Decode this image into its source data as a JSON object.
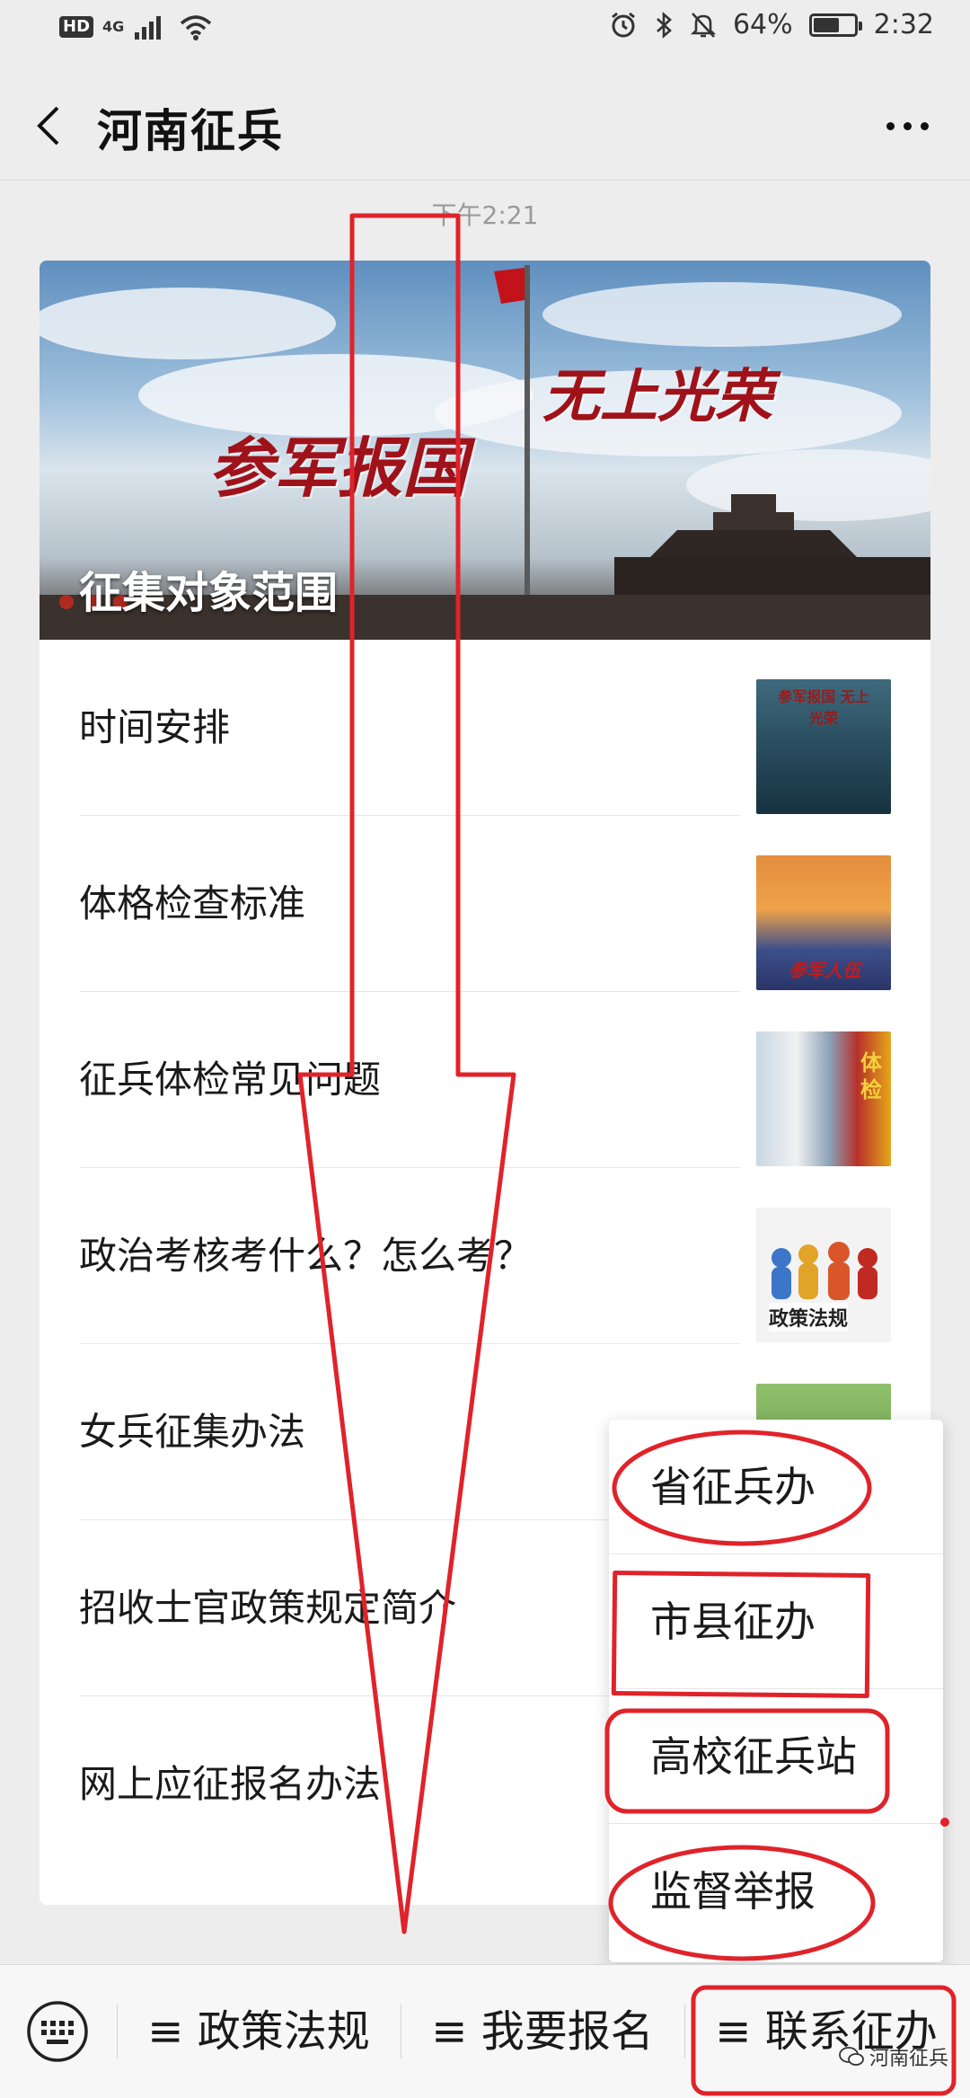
{
  "status_bar": {
    "hd": "HD",
    "network": "4G",
    "battery": "64%",
    "battery_level": 0.64,
    "time": "2:32",
    "icons": [
      "signal-icon",
      "wifi-icon",
      "alarm-icon",
      "bluetooth-icon",
      "mute-icon",
      "battery-icon"
    ]
  },
  "header": {
    "title": "河南征兵"
  },
  "timestamp": "下午2:21",
  "article": {
    "cover_title": "征集对象范围",
    "cover_slogans": [
      "参军报国",
      "无上光荣"
    ],
    "items": [
      {
        "title": "时间安排",
        "thumb_text": "参军报国 无上光荣"
      },
      {
        "title": "体格检查标准",
        "thumb_text": "参军人伍"
      },
      {
        "title": "征兵体检常见问题",
        "thumb_text": "体检"
      },
      {
        "title": "政治考核考什么？怎么考？",
        "thumb_text": "政策法规"
      },
      {
        "title": "女兵征集办法",
        "thumb_text": ""
      },
      {
        "title": "招收士官政策规定简介",
        "thumb_text": ""
      },
      {
        "title": "网上应征报名办法",
        "thumb_text": ""
      }
    ]
  },
  "menu_popup": {
    "items": [
      "省征兵办",
      "市县征办",
      "高校征兵站",
      "监督举报"
    ]
  },
  "bottom_bar": {
    "menus": [
      "≡ 政策法规",
      "≡ 我要报名",
      "≡ 联系征办"
    ],
    "watermark": "河南征兵"
  },
  "colors": {
    "annotation_red": "#e0232a",
    "background": "#ededed"
  }
}
